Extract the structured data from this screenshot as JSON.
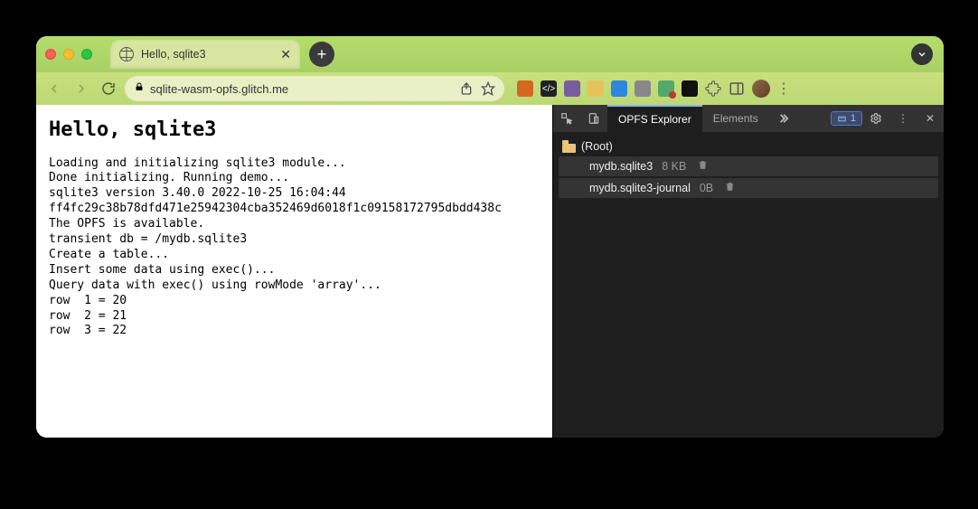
{
  "tab": {
    "title": "Hello, sqlite3"
  },
  "address": {
    "url": "sqlite-wasm-opfs.glitch.me"
  },
  "page": {
    "heading": "Hello, sqlite3",
    "console_lines": [
      "Loading and initializing sqlite3 module...",
      "Done initializing. Running demo...",
      "sqlite3 version 3.40.0 2022-10-25 16:04:44",
      "ff4fc29c38b78dfd471e25942304cba352469d6018f1c09158172795dbdd438c",
      "The OPFS is available.",
      "transient db = /mydb.sqlite3",
      "Create a table...",
      "Insert some data using exec()...",
      "Query data with exec() using rowMode 'array'...",
      "row  1 = 20",
      "row  2 = 21",
      "row  3 = 22"
    ]
  },
  "devtools": {
    "tabs": {
      "active": "OPFS Explorer",
      "secondary": "Elements"
    },
    "error_count": "1",
    "tree": {
      "root_label": "(Root)",
      "files": [
        {
          "name": "mydb.sqlite3",
          "size": "8 KB"
        },
        {
          "name": "mydb.sqlite3-journal",
          "size": "0B"
        }
      ]
    }
  }
}
